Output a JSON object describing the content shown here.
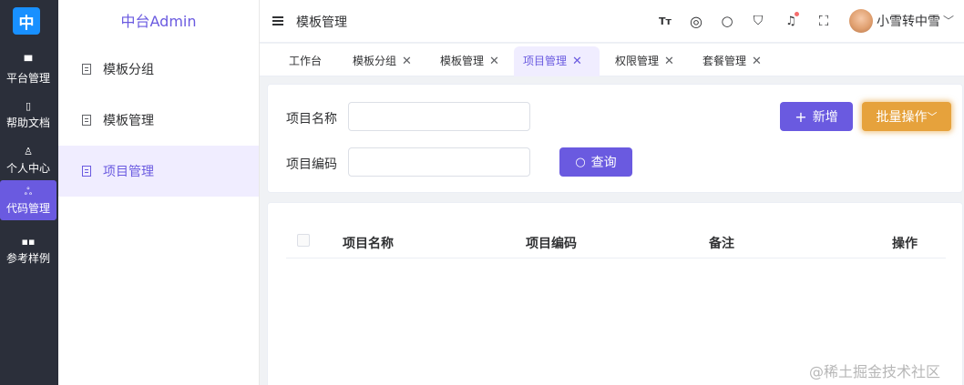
{
  "logo": "中",
  "rail": [
    {
      "icon": "monitor-icon",
      "glyph": "▀",
      "label": "平台管理"
    },
    {
      "icon": "book-icon",
      "glyph": "▯",
      "label": "帮助文档"
    },
    {
      "icon": "user-icon",
      "glyph": "♙",
      "label": "个人中心"
    },
    {
      "icon": "code-icon",
      "glyph": "ஃ",
      "label": "代码管理"
    },
    {
      "icon": "grid-icon",
      "glyph": "▪▪",
      "label": "参考样例"
    }
  ],
  "submenu": {
    "title": "中台Admin",
    "items": [
      "模板分组",
      "模板管理",
      "项目管理"
    ]
  },
  "header": {
    "breadcrumb": "模板管理",
    "font_glyph": "Tт",
    "globe_glyph": "◎",
    "search_glyph": "○",
    "shirt_glyph": "⛉",
    "bell_glyph": "♫",
    "fullscreen_glyph": "⛶",
    "username": "小雪转中雪",
    "chevron": "﹀"
  },
  "tabs": [
    {
      "label": "工作台",
      "close": ""
    },
    {
      "label": "模板分组",
      "close": "✕"
    },
    {
      "label": "模板管理",
      "close": "✕"
    },
    {
      "label": "项目管理",
      "close": "✕"
    },
    {
      "label": "权限管理",
      "close": "✕"
    },
    {
      "label": "套餐管理",
      "close": "✕"
    }
  ],
  "search": {
    "name_label": "项目名称",
    "code_label": "项目编码",
    "name_value": "",
    "code_value": "",
    "query_icon": "○",
    "query_label": "查询",
    "add_icon": "+",
    "add_label": "新增",
    "batch_label": "批量操作",
    "batch_chevron": "﹀"
  },
  "table": {
    "columns": [
      "项目名称",
      "项目编码",
      "备注",
      "操作"
    ]
  },
  "watermark": "@稀土掘金技术社区",
  "colors": {
    "accent": "#6a5ae0",
    "warning": "#e6a23c",
    "rail": "#2b2f3a",
    "logo": "#1890ff"
  }
}
